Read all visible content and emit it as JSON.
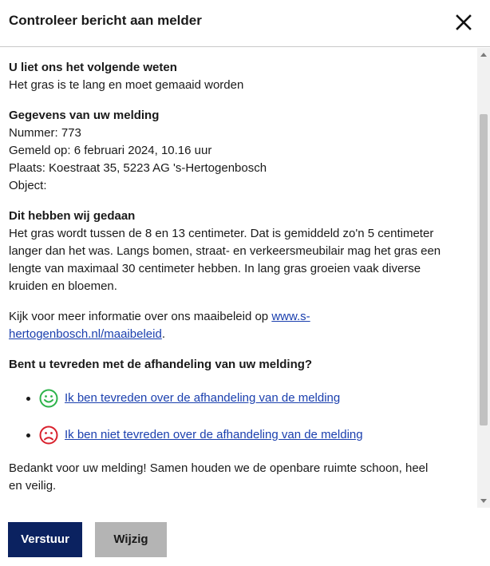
{
  "dialog": {
    "title": "Controleer bericht aan melder",
    "close_icon": "close-icon"
  },
  "message": {
    "heading": "U liet ons het volgende weten",
    "text": "Het gras is te lang en moet gemaaid worden"
  },
  "report": {
    "heading": "Gegevens van uw melding",
    "number": "Nummer: 773",
    "reported_on": "Gemeld op: 6 februari 2024, 10.16 uur",
    "location": "Plaats: Koestraat 35, 5223 AG 's-Hertogenbosch",
    "object": "Object:"
  },
  "action": {
    "heading": "Dit hebben wij gedaan",
    "lines": [
      "Het gras wordt tussen de 8 en 13 centimeter. Dat is gemiddeld zo'n 5 centimeter",
      "langer dan het was. Langs bomen, straat- en verkeersmeubilair mag het gras een",
      "lengte van maximaal 30 centimeter hebben. In lang gras groeien vaak diverse",
      "kruiden en bloemen."
    ]
  },
  "info": {
    "prefix": "Kijk voor meer informatie over ons maaibeleid op ",
    "link_part1": "www.s-",
    "link_part2": "hertogenbosch.nl/maaibeleid",
    "suffix": "."
  },
  "survey": {
    "question": "Bent u tevreden met de afhandeling van uw melding?",
    "options": [
      {
        "label": "Ik ben tevreden over de afhandeling van de melding",
        "icon": "happy-smiley-icon",
        "color": "#2db34a"
      },
      {
        "label": "Ik ben niet tevreden over de afhandeling van de melding",
        "icon": "sad-smiley-icon",
        "color": "#d9202c"
      }
    ]
  },
  "closing": {
    "line1": "Bedankt voor uw melding! Samen houden we de openbare ruimte schoon, heel",
    "line2": "en veilig."
  },
  "buttons": {
    "submit": "Verstuur",
    "edit": "Wijzig"
  },
  "colors": {
    "primary": "#0b2260",
    "secondary": "#b4b4b4",
    "link": "#1a3fae"
  }
}
